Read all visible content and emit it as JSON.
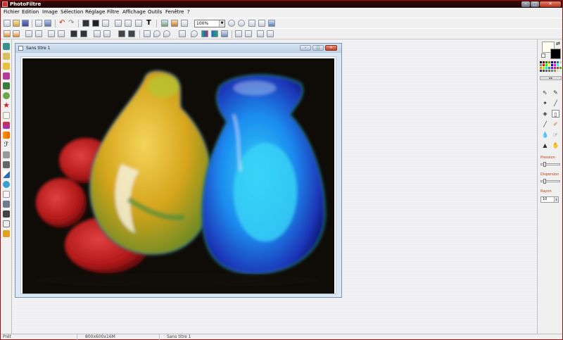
{
  "window": {
    "title": "PhotoFiltre"
  },
  "menu": [
    "Fichier",
    "Edition",
    "Image",
    "Sélection",
    "Réglage",
    "Filtre",
    "Affichage",
    "Outils",
    "Fenêtre",
    "?"
  ],
  "toolbar": {
    "zoom_value": "100%"
  },
  "document": {
    "title": "Sans titre 1"
  },
  "right_panel": {
    "pression_label": "Pression",
    "dispersion_label": "Dispersion",
    "rayon_label": "Rayon",
    "rayon_value": "10"
  },
  "status": {
    "state": "Prêt",
    "dimensions": "800x600x16M",
    "filename": "Sans titre 1"
  },
  "colors": {
    "foreground": "#000000",
    "background": "#fffff0",
    "accent_label": "#c03a10"
  },
  "icons": [
    "new-icon",
    "open-icon",
    "save-icon",
    "print-icon",
    "undo-icon",
    "redo-icon",
    "text-icon",
    "zoom-in-icon",
    "zoom-out-icon",
    "brush-icon",
    "pipette-icon",
    "wand-icon",
    "fill-icon",
    "hand-icon"
  ]
}
